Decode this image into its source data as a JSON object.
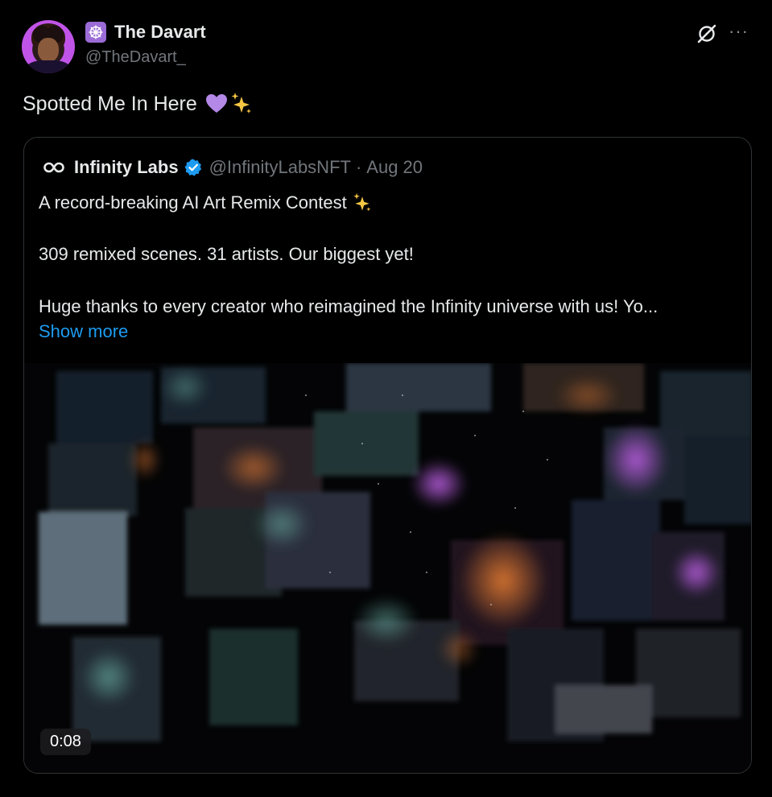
{
  "author": {
    "name": "The Davart",
    "handle": "@TheDavart_",
    "badge_icon": "dharma-wheel-icon"
  },
  "post": {
    "text": "Spotted Me In Here",
    "emojis": [
      "purple-heart",
      "sparkles"
    ]
  },
  "quoted": {
    "name": "Infinity Labs",
    "handle": "@InfinityLabsNFT",
    "separator": "·",
    "date": "Aug 20",
    "line1": "A record-breaking AI Art Remix Contest",
    "line2": "309 remixed scenes. 31 artists. Our biggest yet!",
    "line3": "Huge thanks to every creator who reimagined the Infinity universe with us! Yo...",
    "show_more": "Show more",
    "video": {
      "duration": "0:08"
    }
  },
  "colors": {
    "background": "#000000",
    "text": "#e7e9ea",
    "muted": "#71767b",
    "link": "#1d9bf0",
    "verified": "#1d9bf0",
    "border": "#2f3336"
  }
}
